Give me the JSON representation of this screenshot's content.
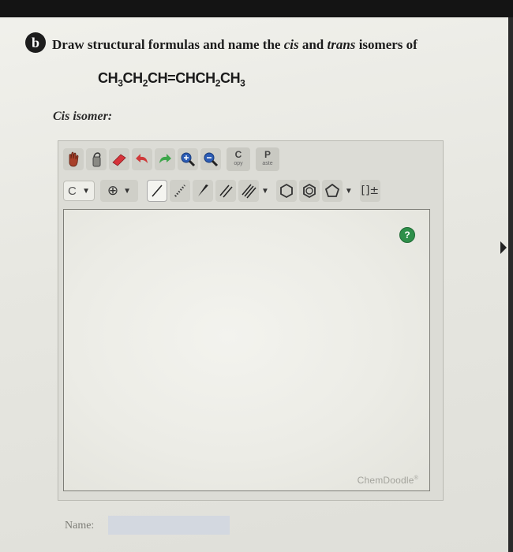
{
  "question": {
    "badge": "b",
    "text_prefix": "Draw structural formulas and name the ",
    "cis_word": "cis",
    "text_middle": " and ",
    "trans_word": "trans",
    "text_suffix": " isomers of"
  },
  "formula": {
    "parts": [
      "CH",
      "3",
      "CH",
      "2",
      "CH=CHCH",
      "2",
      "CH",
      "3"
    ]
  },
  "cis_label": "Cis isomer:",
  "toolbar": {
    "copy_letter": "C",
    "copy_sub": "opy",
    "paste_letter": "P",
    "paste_sub": "aste",
    "element_value": "C",
    "charge_symbol": "⊕",
    "bracket_label": "[]±"
  },
  "canvas": {
    "help_symbol": "?",
    "logo_text": "ChemDoodle",
    "logo_mark": "®"
  },
  "name_field": {
    "label": "Name:",
    "value": ""
  },
  "colors": {
    "help_green": "#2e8f4a",
    "eraser_red": "#d6333a",
    "undo_red": "#cf3a3a",
    "redo_green": "#3da64a",
    "zoom_blue": "#2d5db5"
  }
}
